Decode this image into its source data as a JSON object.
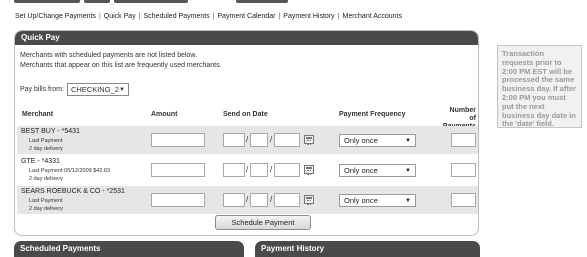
{
  "subnav": {
    "items": [
      "Set Up/Change Payments",
      "Quick Pay",
      "Scheduled Payments",
      "Payment Calendar",
      "Payment History",
      "Merchant Accounts"
    ],
    "separator": "|"
  },
  "quick_pay": {
    "title": "Quick Pay",
    "intro_line1": "Merchants with scheduled payments are not listed below.",
    "intro_line2": "Merchants that appear on this list are frequently used merchants.",
    "pay_bills_label": "Pay bills from:",
    "pay_bills_value": "CHECKING_2",
    "columns": {
      "merchant": "Merchant",
      "amount": "Amount",
      "send_on_date": "Send on Date",
      "payment_frequency": "Payment Frequency",
      "number_of_payments_1": "Number of",
      "number_of_payments_2": "Payments"
    },
    "rows": [
      {
        "merchant": "BEST BUY - *5431",
        "last_payment": "Last Payment",
        "delivery": "2 day delivery",
        "frequency": "Only once"
      },
      {
        "merchant": "GTE - *4331",
        "last_payment": "Last Payment  05/12/2009  $42.83",
        "delivery": "2 day delivery",
        "frequency": "Only once"
      },
      {
        "merchant": "SEARS ROEBUCK & CO - *2531",
        "last_payment": "Last Payment",
        "delivery": "2 day delivery",
        "frequency": "Only once"
      }
    ],
    "date_separator": "/",
    "schedule_button": "Schedule Payment"
  },
  "sidebar_note": "Transaction requests prior to 2:00 PM EST will be processed the same business day. If after 2:00 PM you must put the next business day date in the 'date' field.",
  "bottom_panels": {
    "scheduled_payments": "Scheduled Payments",
    "payment_history": "Payment History"
  },
  "icons": {
    "dropdown": "chevron-down-icon",
    "calendar": "calendar-icon"
  }
}
